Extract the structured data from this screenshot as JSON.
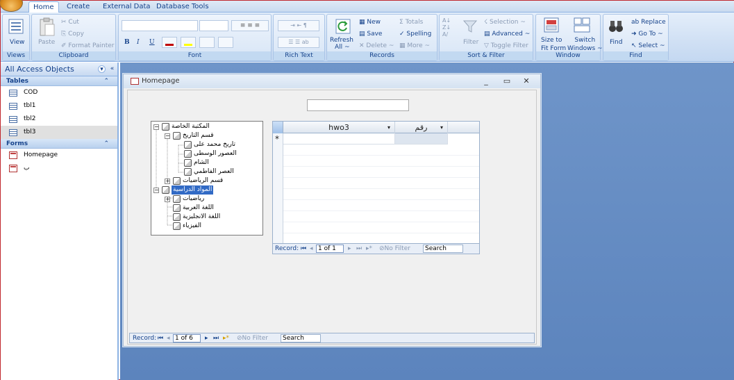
{
  "ribbon_tabs": [
    "Home",
    "Create",
    "External Data",
    "Database Tools"
  ],
  "groups": {
    "views": {
      "label": "Views",
      "view": "View"
    },
    "clipboard": {
      "label": "Clipboard",
      "paste": "Paste",
      "cut": "Cut",
      "copy": "Copy",
      "format_painter": "Format Painter"
    },
    "font": {
      "label": "Font",
      "bold": "B",
      "italic": "I",
      "underline": "U"
    },
    "rich_text": {
      "label": "Rich Text"
    },
    "records": {
      "label": "Records",
      "refresh": "Refresh",
      "refresh2": "All ~",
      "new": "New",
      "save": "Save",
      "delete": "Delete ~",
      "totals": "Totals",
      "spelling": "Spelling",
      "more": "More ~"
    },
    "sort_filter": {
      "label": "Sort & Filter",
      "filter": "Filter",
      "selection": "Selection ~",
      "advanced": "Advanced ~",
      "toggle_filter": "Toggle Filter"
    },
    "window": {
      "label": "Window",
      "size_to": "Size to",
      "fit_form": "Fit Form",
      "switch": "Switch",
      "windows": "Windows ~"
    },
    "find": {
      "label": "Find",
      "find": "Find",
      "replace": "Replace",
      "go_to": "Go To ~",
      "select": "Select ~"
    }
  },
  "nav_pane": {
    "header": "All Access Objects",
    "tables_label": "Tables",
    "tables": [
      "COD",
      "tbl1",
      "tbl2",
      "tbl3"
    ],
    "forms_label": "Forms",
    "forms": [
      "Homepage",
      "ب"
    ]
  },
  "form_window": {
    "title": "Homepage",
    "tree": [
      "المكتبة الخاصة",
      "قسم التاريخ",
      "تاريخ محمد على",
      "العصور الوسطى",
      "الشام",
      "العصر الفاطمي",
      "قسم الرياضيات",
      "المواد الدراسية",
      "رياضيات",
      "اللغة العربية",
      "اللغة الانجليزية",
      "الفيزياء"
    ],
    "grid": {
      "columns": [
        "hwo3",
        "رقم"
      ],
      "new_row_marker": "*",
      "record_label": "Record:",
      "record_value": "1 of 1",
      "no_filter": "No Filter",
      "search": "Search"
    },
    "form_nav": {
      "record_label": "Record:",
      "record_value": "1 of 6",
      "no_filter": "No Filter",
      "search": "Search"
    }
  }
}
